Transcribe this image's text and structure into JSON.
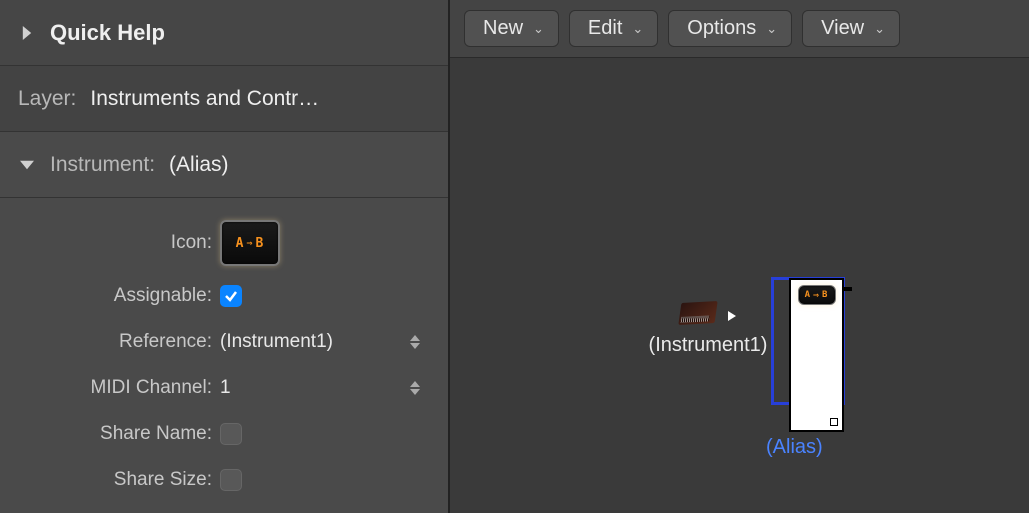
{
  "left": {
    "quick_help_title": "Quick Help",
    "layer": {
      "label": "Layer:",
      "value": "Instruments and Contr…"
    },
    "instrument_header": {
      "label": "Instrument:",
      "value": "(Alias)"
    },
    "rows": {
      "icon": {
        "label": "Icon:",
        "thumb": "A⇒B"
      },
      "assignable": {
        "label": "Assignable:",
        "checked": true
      },
      "reference": {
        "label": "Reference:",
        "value": "(Instrument1)"
      },
      "midi_channel": {
        "label": "MIDI Channel:",
        "value": "1"
      },
      "share_name": {
        "label": "Share Name:",
        "checked": false
      },
      "share_size": {
        "label": "Share Size:",
        "checked": false
      }
    }
  },
  "toolbar": {
    "new": "New",
    "edit": "Edit",
    "options": "Options",
    "view": "View"
  },
  "canvas": {
    "instrument1_label": "(Instrument1)",
    "alias_label": "(Alias)"
  }
}
